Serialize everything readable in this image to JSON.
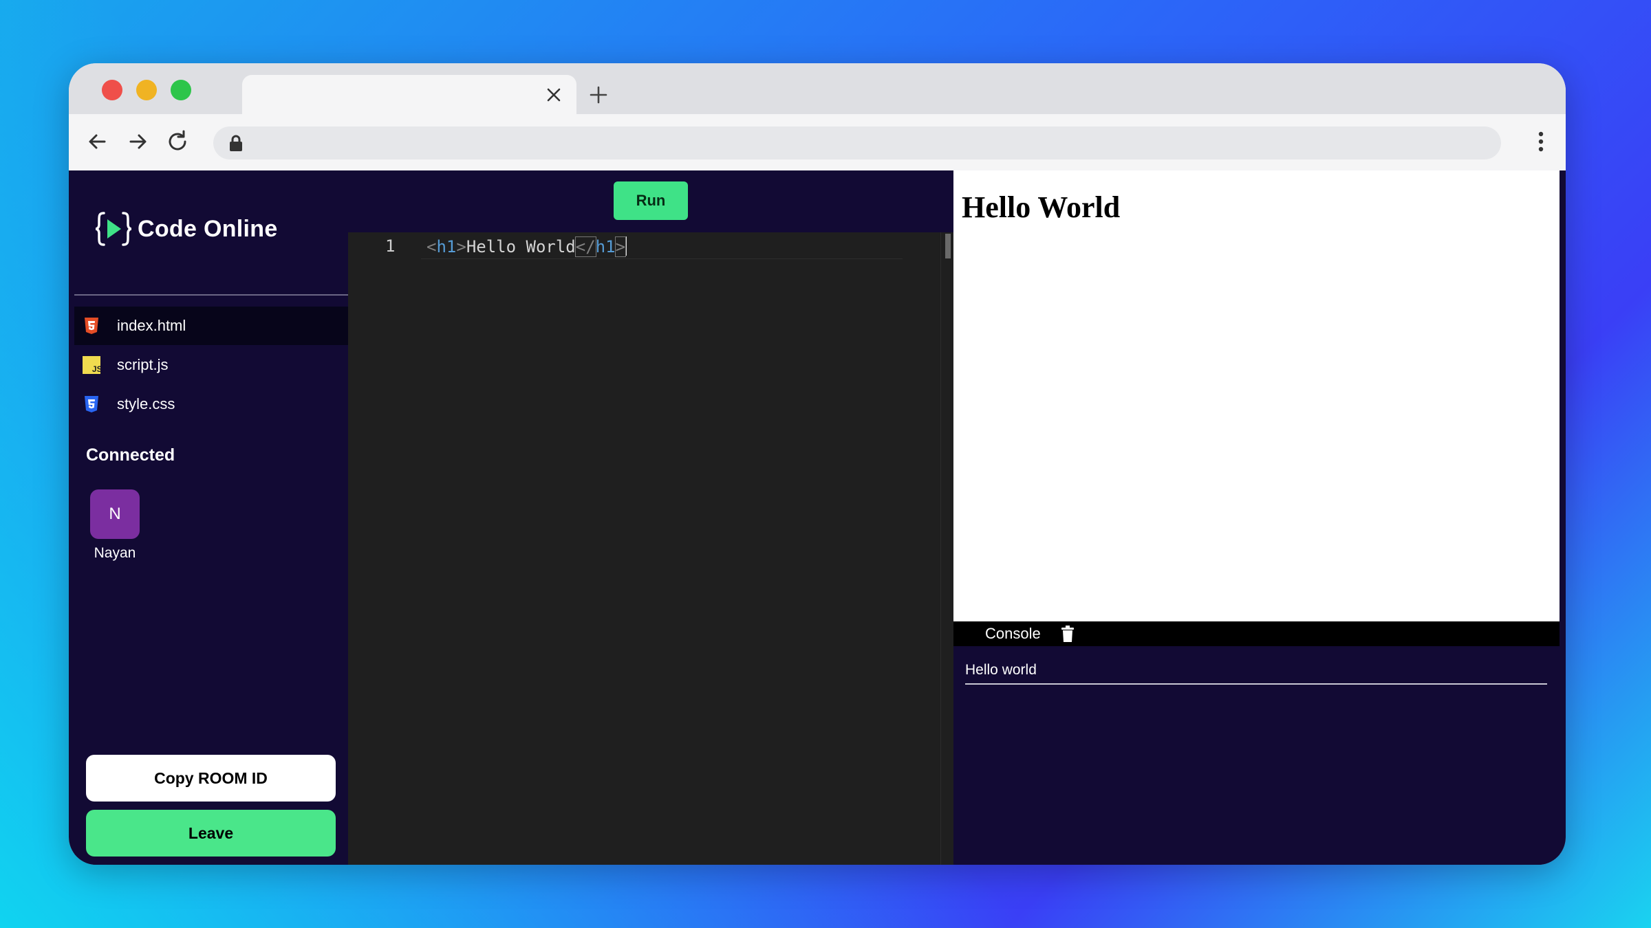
{
  "browser": {
    "tab": {
      "title": ""
    },
    "url": ""
  },
  "app": {
    "logo_text": "Code Online",
    "run_label": "Run",
    "files": [
      {
        "name": "index.html",
        "type": "html",
        "active": true
      },
      {
        "name": "script.js",
        "type": "js",
        "active": false
      },
      {
        "name": "style.css",
        "type": "css",
        "active": false
      }
    ],
    "connected_heading": "Connected",
    "user": {
      "initial": "N",
      "name": "Nayan"
    },
    "copy_label": "Copy ROOM ID",
    "leave_label": "Leave"
  },
  "editor": {
    "line_number": "1",
    "tokens": {
      "open_lt": "<",
      "open_name": "h1",
      "open_gt": ">",
      "text": "Hello World",
      "close_lt": "</",
      "close_name": "h1",
      "close_gt": ">"
    }
  },
  "preview": {
    "heading": "Hello World"
  },
  "console": {
    "label": "Console",
    "lines": [
      "Hello world"
    ]
  },
  "colors": {
    "app_bg": "#120a34",
    "accent_green": "#3fe287",
    "avatar": "#7b2ea0",
    "html_icon": "#e44d26",
    "js_icon": "#f0db4f",
    "css_icon": "#2965f1"
  }
}
